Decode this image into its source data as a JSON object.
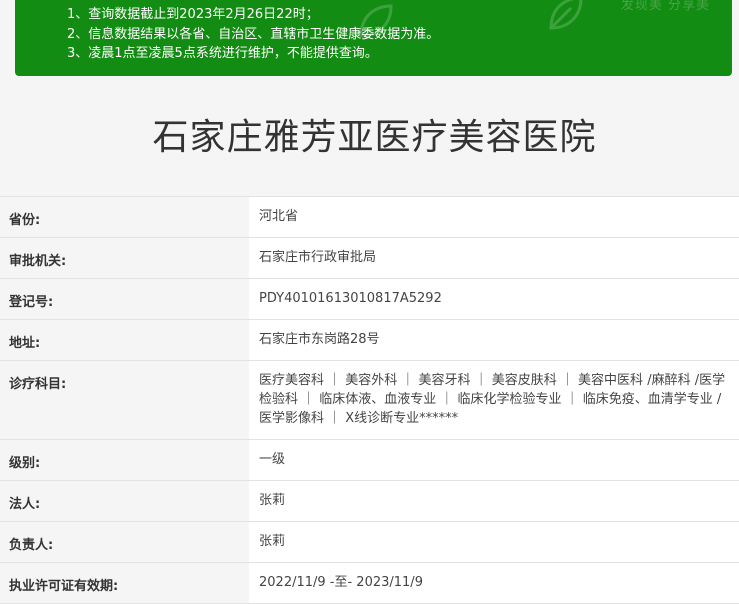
{
  "notice": {
    "lines": [
      "1、查询数据截止到2023年2月26日22时；",
      "2、信息数据结果以各省、自治区、直辖市卫生健康委数据为准。",
      "3、凌晨1点至凌晨5点系统进行维护，不能提供查询。"
    ],
    "watermark": "发现美 分享美",
    "background_color": "#128c12"
  },
  "hospital": {
    "name": "石家庄雅芳亚医疗美容医院"
  },
  "fields": [
    {
      "label": "省份:",
      "value": "河北省"
    },
    {
      "label": "审批机关:",
      "value": "石家庄市行政审批局"
    },
    {
      "label": "登记号:",
      "value": "PDY40101613010817A5292"
    },
    {
      "label": "地址:",
      "value": "石家庄市东岗路28号"
    },
    {
      "label": "诊疗科目:",
      "value": "医疗美容科 ｜ 美容外科 ｜ 美容牙科 ｜ 美容皮肤科 ｜ 美容中医科 /麻醉科 /医学检验科 ｜ 临床体液、血液专业 ｜ 临床化学检验专业 ｜ 临床免疫、血清学专业 /医学影像科 ｜ X线诊断专业******"
    },
    {
      "label": "级别:",
      "value": "一级"
    },
    {
      "label": "法人:",
      "value": "张莉"
    },
    {
      "label": "负责人:",
      "value": "张莉"
    },
    {
      "label": "执业许可证有效期:",
      "value": "2022/11/9 -至- 2023/11/9"
    }
  ]
}
